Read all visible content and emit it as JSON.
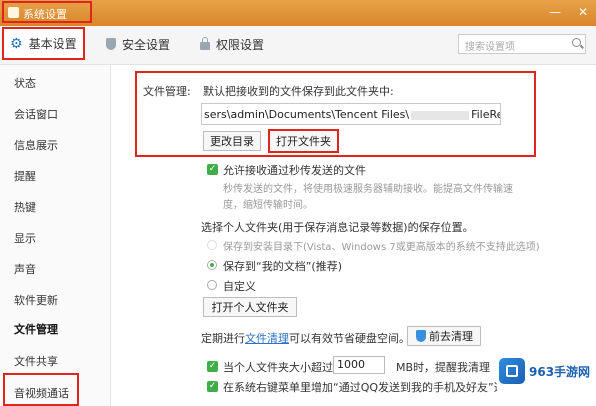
{
  "window": {
    "title": "系统设置"
  },
  "tabs": [
    {
      "label": "基本设置",
      "icon": "gear-icon",
      "active": true
    },
    {
      "label": "安全设置",
      "icon": "shield-icon",
      "active": false
    },
    {
      "label": "权限设置",
      "icon": "lock-icon",
      "active": false
    }
  ],
  "search": {
    "placeholder": "搜索设置项"
  },
  "sidebar": {
    "items": [
      {
        "label": "状态"
      },
      {
        "label": "会话窗口"
      },
      {
        "label": "信息展示"
      },
      {
        "label": "提醒"
      },
      {
        "label": "热键"
      },
      {
        "label": "显示"
      },
      {
        "label": "声音"
      },
      {
        "label": "软件更新"
      },
      {
        "label": "文件管理",
        "active": true
      },
      {
        "label": "文件共享"
      },
      {
        "label": "音视频通话"
      }
    ]
  },
  "file_management": {
    "section_label": "文件管理:",
    "description": "默认把接收到的文件保存到此文件夹中:",
    "path_prefix": "sers\\admin\\Documents\\Tencent Files\\",
    "path_suffix": "FileRecv\\",
    "change_dir_button": "更改目录",
    "open_folder_button": "打开文件夹"
  },
  "transfer": {
    "checkbox_label": "允许接收通过秒传发送的文件",
    "desc_line1": "秒传发送的文件，将使用极速服务器辅助接收。能提高文件传输速",
    "desc_line2": "度，缩短传输时间。"
  },
  "personal_folder": {
    "title": "选择个人文件夹(用于保存消息记录等数据)的保存位置。",
    "option_install_dir": "保存到安装目录下(Vista、Windows 7或更高版本的系统不支持此选项)",
    "option_my_docs": "保存到“我的文档”(推荐)",
    "option_custom": "自定义",
    "open_button": "打开个人文件夹"
  },
  "cleanup": {
    "text_before": "定期进行",
    "link": "文件清理",
    "text_after": "可以有效节省硬盘空间。",
    "button": "前去清理"
  },
  "limit": {
    "checkbox_label": "当个人文件夹大小超过",
    "value": "1000",
    "text_after": "MB时，提醒我清理"
  },
  "context_menu": {
    "checkbox_label": "在系统右键菜单里增加“通过QQ发送到我的手机及好友”选"
  },
  "watermark": {
    "text": "963手游网"
  },
  "colors": {
    "title_bar": "#e0952f",
    "highlight_border": "#e0241e",
    "check_green": "#3fae49",
    "link_blue": "#2a6fc9"
  }
}
